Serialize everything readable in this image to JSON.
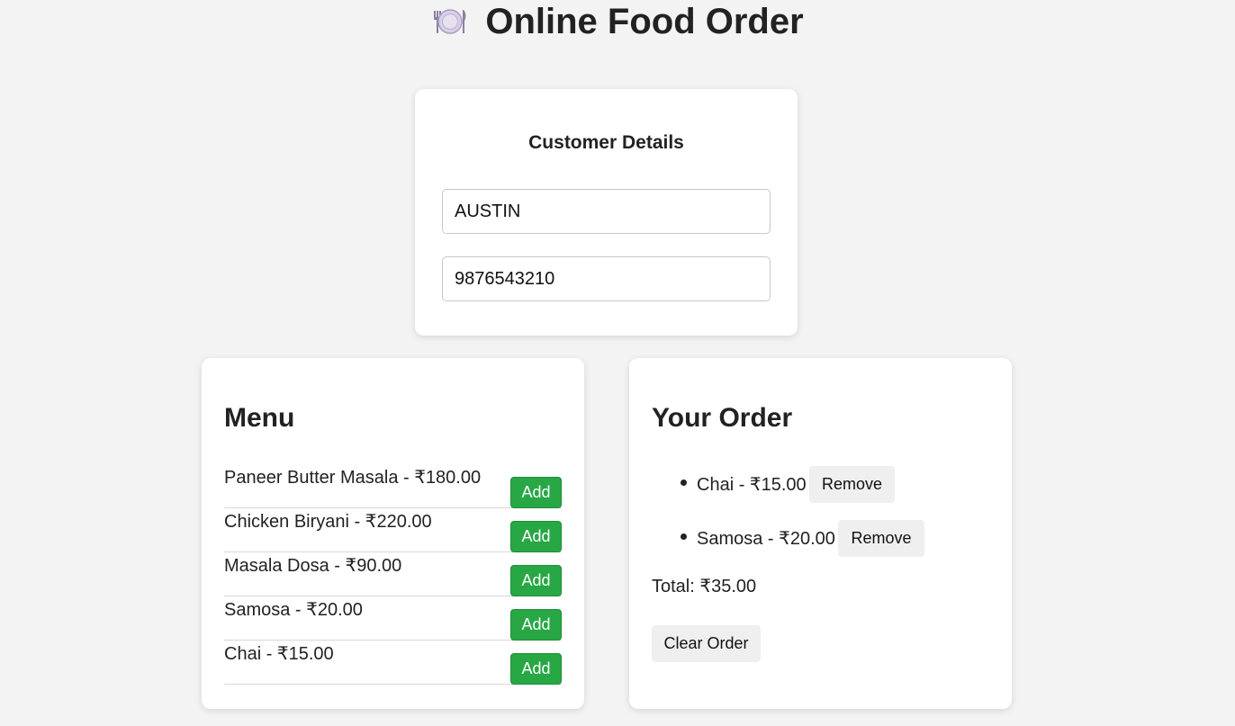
{
  "header": {
    "icon": "plate-cutlery-icon",
    "title": "Online Food Order"
  },
  "customer": {
    "heading": "Customer Details",
    "name_value": "AUSTIN",
    "phone_value": "9876543210"
  },
  "menu": {
    "heading": "Menu",
    "items": [
      {
        "label": "Paneer Butter Masala - ₹180.00",
        "button": "Add"
      },
      {
        "label": "Chicken Biryani - ₹220.00",
        "button": "Add"
      },
      {
        "label": "Masala Dosa - ₹90.00",
        "button": "Add"
      },
      {
        "label": "Samosa - ₹20.00",
        "button": "Add"
      },
      {
        "label": "Chai - ₹15.00",
        "button": "Add"
      }
    ]
  },
  "order": {
    "heading": "Your Order",
    "items": [
      {
        "label": "Chai - ₹15.00",
        "button": "Remove"
      },
      {
        "label": "Samosa - ₹20.00",
        "button": "Remove"
      }
    ],
    "total": "Total: ₹35.00",
    "clear_label": "Clear Order"
  },
  "colors": {
    "background": "#f3f3f3",
    "add_button": "#28a745",
    "secondary_button": "#efefef"
  }
}
